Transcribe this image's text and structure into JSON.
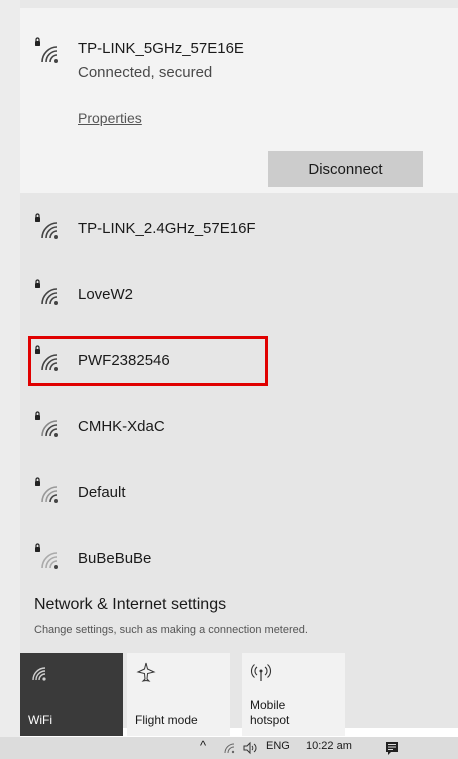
{
  "connected": {
    "name": "TP-LINK_5GHz_57E16E",
    "status": "Connected, secured",
    "properties_label": "Properties",
    "disconnect_label": "Disconnect"
  },
  "networks": [
    {
      "name": "TP-LINK_2.4GHz_57E16F",
      "icon": "wifi-secured-icon"
    },
    {
      "name": "LoveW2",
      "icon": "wifi-secured-icon"
    },
    {
      "name": "PWF2382546",
      "icon": "wifi-secured-icon",
      "highlighted": true
    },
    {
      "name": "CMHK-XdaC",
      "icon": "wifi-secured-icon"
    },
    {
      "name": "Default",
      "icon": "wifi-secured-icon"
    },
    {
      "name": "BuBeBuBe",
      "icon": "wifi-secured-icon"
    }
  ],
  "settings": {
    "title": "Network & Internet settings",
    "subtitle": "Change settings, such as making a connection metered."
  },
  "quick_actions": [
    {
      "label": "WiFi",
      "icon": "wifi-icon",
      "active": true
    },
    {
      "label": "Flight mode",
      "icon": "airplane-icon",
      "active": false
    },
    {
      "label": "Mobile\nhotspot",
      "icon": "hotspot-icon",
      "active": false
    }
  ],
  "taskbar": {
    "language": "ENG",
    "time": "10:22 am"
  },
  "colors": {
    "highlight": "#e00000",
    "active_tile": "#3a3a3a"
  }
}
